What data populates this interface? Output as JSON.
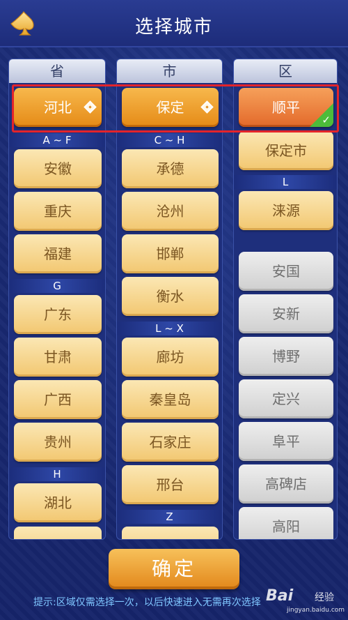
{
  "header": {
    "title": "选择城市",
    "back_icon": "spade-back-icon"
  },
  "columns": {
    "province": {
      "heading": "省"
    },
    "city": {
      "heading": "市"
    },
    "district": {
      "heading": "区"
    }
  },
  "selected": {
    "province": "河北",
    "city": "保定",
    "district": "顺平"
  },
  "provinces": {
    "group_af": "A ~ F",
    "af": [
      "安徽",
      "重庆",
      "福建"
    ],
    "group_g": "G",
    "g": [
      "广东",
      "甘肃",
      "广西",
      "贵州"
    ],
    "group_h": "H",
    "h": [
      "湖北"
    ]
  },
  "cities": {
    "group_ch": "C ~ H",
    "ch": [
      "承德",
      "沧州",
      "邯郸",
      "衡水"
    ],
    "group_lx": "L ~ X",
    "lx": [
      "廊坊",
      "秦皇岛",
      "石家庄",
      "邢台"
    ],
    "group_z": "Z"
  },
  "districts": {
    "top": [
      "保定市"
    ],
    "group_l": "L",
    "l": [
      "涞源"
    ],
    "greyed": [
      "安国",
      "安新",
      "博野",
      "定兴",
      "阜平",
      "高碑店",
      "高阳"
    ]
  },
  "confirm_label": "确定",
  "hint": "提示:区域仅需选择一次，以后快速进入无需再次选择",
  "watermark": {
    "brand": "Bai",
    "jy": "经验",
    "url": "jingyan.baidu.com"
  },
  "colors": {
    "background": "#1c2d78",
    "accent_orange": "#e58a16",
    "highlight_red": "#e3242b",
    "check_green": "#4cbc3a"
  }
}
